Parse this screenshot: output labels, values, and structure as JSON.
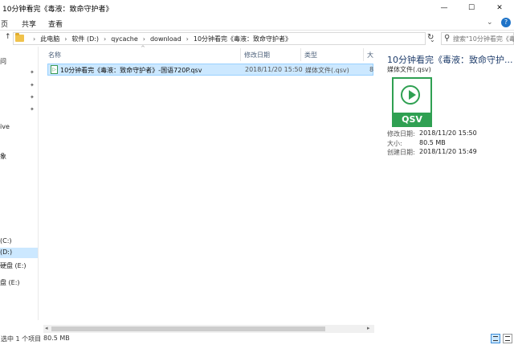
{
  "window": {
    "title": "10分钟看完《毒液：致命守护者》",
    "min_glyph": "—",
    "max_glyph": "☐",
    "close_glyph": "✕"
  },
  "ribbon": {
    "tabs": [
      "页",
      "共享",
      "查看"
    ],
    "toggle_glyph": "⌄",
    "help_glyph": "?"
  },
  "address": {
    "up_glyph": "↑",
    "crumbs": [
      "此电脑",
      "软件 (D:)",
      "qycache",
      "download",
      "10分钟看完《毒液：致命守护者》"
    ],
    "separator": "›",
    "dropdown_glyph": "⌄",
    "refresh_glyph": "↻"
  },
  "search": {
    "icon_glyph": "⚲",
    "placeholder": "搜索\"10分钟看完《毒..."
  },
  "navpane": {
    "pin_glyph": "📌",
    "items": [
      {
        "label": "问"
      },
      {
        "label": ""
      },
      {
        "label": ""
      },
      {
        "label": ""
      },
      {
        "label": "ive"
      },
      {
        "label": "象"
      },
      {
        "label": "(C:)"
      },
      {
        "label": "(D:)"
      },
      {
        "label": "硬盘 (E:)"
      },
      {
        "label": "盘 (E:)"
      }
    ]
  },
  "filelist": {
    "columns": [
      "名称",
      "修改日期",
      "类型",
      "大"
    ],
    "sort_glyph": "^",
    "rows": [
      {
        "icon": "qsv-file-icon",
        "icon_glyph": "▷",
        "name": "10分钟看完《毒液：致命守护者》-国语720P.qsv",
        "date": "2018/11/20 15:50",
        "type": "媒体文件(.qsv)",
        "size": "8"
      }
    ],
    "scroll_fraction": 0.87
  },
  "preview": {
    "title": "10分钟看完《毒液：致命守护...",
    "type_label": "媒体文件(.qsv)",
    "icon_text": "QSV",
    "icon_color": "#2fa052",
    "properties": [
      {
        "label": "修改日期:",
        "value": "2018/11/20 15:50"
      },
      {
        "label": "大小:",
        "value": "80.5 MB"
      },
      {
        "label": "创建日期:",
        "value": "2018/11/20 15:49"
      }
    ]
  },
  "status": {
    "selection": "选中 1 个项目",
    "size": "80.5 MB"
  },
  "colors": {
    "selection_bg": "#cce8ff",
    "selection_border": "#99d1ff",
    "accent": "#1e73c8"
  }
}
